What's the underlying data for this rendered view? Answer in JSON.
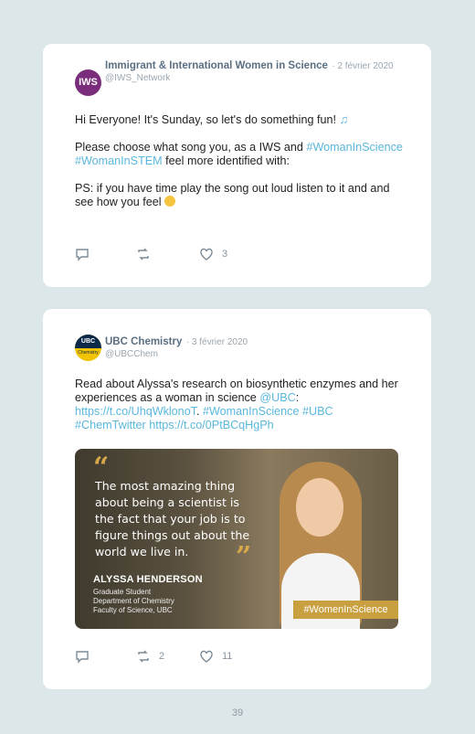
{
  "tweets": [
    {
      "author": "Immigrant & International Women in Science",
      "date": "· 2 février 2020",
      "handle": "@IWS_Network",
      "avatar_text": "IWS",
      "avatar_color": "#7a2d7a",
      "paragraph1_text": "Hi Everyone! It's Sunday, so let's do something fun!",
      "paragraph1_icon": "music-note-icon",
      "paragraph2_text": "Please choose what song you, as a IWS and",
      "paragraph2_hashtag1": "#WomanInScience",
      "paragraph2_hashtag2": "#WomanInSTEM",
      "paragraph2_tail": "feel more identified with:",
      "paragraph3_text": "PS: if you have time play the song out loud listen to it and and see how you feel",
      "paragraph3_icon": "wink-emoji-icon",
      "likes": "3"
    },
    {
      "author": "UBC Chemistry",
      "date": "· 3 février 2020",
      "handle": "@UBCChem",
      "avatar_text_top": "UBC",
      "avatar_text_bottom": "Chemistry",
      "text_part1": "Read about Alyssa's research on biosynthetic enzymes and her experiences as a woman in science",
      "mention": "@UBC",
      "text_colon": ":",
      "link1": "https://t.co/UhqWklonoT",
      "text_dot": ".",
      "hashtag1": "#WomanInScience",
      "hashtag2": "#UBC",
      "hashtag3": "#ChemTwitter",
      "link2": "https://t.co/0PtBCqHgPh",
      "retweets": "2",
      "likes": "11",
      "image": {
        "quote": "The most amazing thing about being a scientist is the fact that your job is to figure things out about the world we live in.",
        "name": "ALYSSA HENDERSON",
        "title_line1": "Graduate Student",
        "title_line2": "Department of Chemistry",
        "title_line3": "Faculty of Science, UBC",
        "hashtag": "#WomenInScience"
      }
    }
  ],
  "page_number": "39",
  "colors": {
    "background": "#dce7ea",
    "link": "#5bb7dd",
    "accent_gold": "#c9a040"
  }
}
